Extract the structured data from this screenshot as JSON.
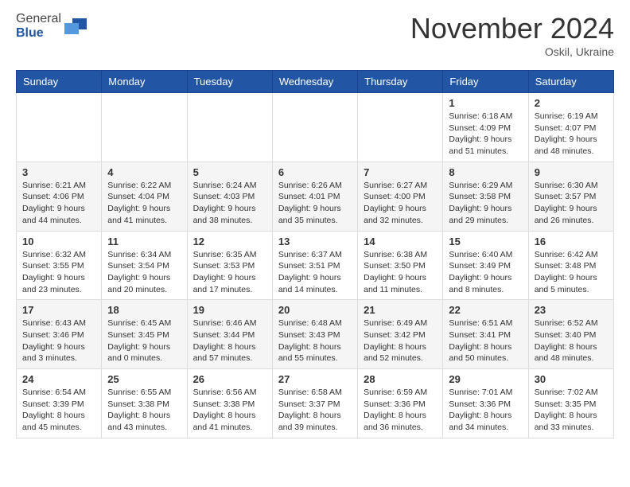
{
  "header": {
    "title": "November 2024",
    "location": "Oskil, Ukraine"
  },
  "columns": [
    "Sunday",
    "Monday",
    "Tuesday",
    "Wednesday",
    "Thursday",
    "Friday",
    "Saturday"
  ],
  "weeks": [
    [
      {
        "day": "",
        "info": ""
      },
      {
        "day": "",
        "info": ""
      },
      {
        "day": "",
        "info": ""
      },
      {
        "day": "",
        "info": ""
      },
      {
        "day": "",
        "info": ""
      },
      {
        "day": "1",
        "info": "Sunrise: 6:18 AM\nSunset: 4:09 PM\nDaylight: 9 hours and 51 minutes."
      },
      {
        "day": "2",
        "info": "Sunrise: 6:19 AM\nSunset: 4:07 PM\nDaylight: 9 hours and 48 minutes."
      }
    ],
    [
      {
        "day": "3",
        "info": "Sunrise: 6:21 AM\nSunset: 4:06 PM\nDaylight: 9 hours and 44 minutes."
      },
      {
        "day": "4",
        "info": "Sunrise: 6:22 AM\nSunset: 4:04 PM\nDaylight: 9 hours and 41 minutes."
      },
      {
        "day": "5",
        "info": "Sunrise: 6:24 AM\nSunset: 4:03 PM\nDaylight: 9 hours and 38 minutes."
      },
      {
        "day": "6",
        "info": "Sunrise: 6:26 AM\nSunset: 4:01 PM\nDaylight: 9 hours and 35 minutes."
      },
      {
        "day": "7",
        "info": "Sunrise: 6:27 AM\nSunset: 4:00 PM\nDaylight: 9 hours and 32 minutes."
      },
      {
        "day": "8",
        "info": "Sunrise: 6:29 AM\nSunset: 3:58 PM\nDaylight: 9 hours and 29 minutes."
      },
      {
        "day": "9",
        "info": "Sunrise: 6:30 AM\nSunset: 3:57 PM\nDaylight: 9 hours and 26 minutes."
      }
    ],
    [
      {
        "day": "10",
        "info": "Sunrise: 6:32 AM\nSunset: 3:55 PM\nDaylight: 9 hours and 23 minutes."
      },
      {
        "day": "11",
        "info": "Sunrise: 6:34 AM\nSunset: 3:54 PM\nDaylight: 9 hours and 20 minutes."
      },
      {
        "day": "12",
        "info": "Sunrise: 6:35 AM\nSunset: 3:53 PM\nDaylight: 9 hours and 17 minutes."
      },
      {
        "day": "13",
        "info": "Sunrise: 6:37 AM\nSunset: 3:51 PM\nDaylight: 9 hours and 14 minutes."
      },
      {
        "day": "14",
        "info": "Sunrise: 6:38 AM\nSunset: 3:50 PM\nDaylight: 9 hours and 11 minutes."
      },
      {
        "day": "15",
        "info": "Sunrise: 6:40 AM\nSunset: 3:49 PM\nDaylight: 9 hours and 8 minutes."
      },
      {
        "day": "16",
        "info": "Sunrise: 6:42 AM\nSunset: 3:48 PM\nDaylight: 9 hours and 5 minutes."
      }
    ],
    [
      {
        "day": "17",
        "info": "Sunrise: 6:43 AM\nSunset: 3:46 PM\nDaylight: 9 hours and 3 minutes."
      },
      {
        "day": "18",
        "info": "Sunrise: 6:45 AM\nSunset: 3:45 PM\nDaylight: 9 hours and 0 minutes."
      },
      {
        "day": "19",
        "info": "Sunrise: 6:46 AM\nSunset: 3:44 PM\nDaylight: 8 hours and 57 minutes."
      },
      {
        "day": "20",
        "info": "Sunrise: 6:48 AM\nSunset: 3:43 PM\nDaylight: 8 hours and 55 minutes."
      },
      {
        "day": "21",
        "info": "Sunrise: 6:49 AM\nSunset: 3:42 PM\nDaylight: 8 hours and 52 minutes."
      },
      {
        "day": "22",
        "info": "Sunrise: 6:51 AM\nSunset: 3:41 PM\nDaylight: 8 hours and 50 minutes."
      },
      {
        "day": "23",
        "info": "Sunrise: 6:52 AM\nSunset: 3:40 PM\nDaylight: 8 hours and 48 minutes."
      }
    ],
    [
      {
        "day": "24",
        "info": "Sunrise: 6:54 AM\nSunset: 3:39 PM\nDaylight: 8 hours and 45 minutes."
      },
      {
        "day": "25",
        "info": "Sunrise: 6:55 AM\nSunset: 3:38 PM\nDaylight: 8 hours and 43 minutes."
      },
      {
        "day": "26",
        "info": "Sunrise: 6:56 AM\nSunset: 3:38 PM\nDaylight: 8 hours and 41 minutes."
      },
      {
        "day": "27",
        "info": "Sunrise: 6:58 AM\nSunset: 3:37 PM\nDaylight: 8 hours and 39 minutes."
      },
      {
        "day": "28",
        "info": "Sunrise: 6:59 AM\nSunset: 3:36 PM\nDaylight: 8 hours and 36 minutes."
      },
      {
        "day": "29",
        "info": "Sunrise: 7:01 AM\nSunset: 3:36 PM\nDaylight: 8 hours and 34 minutes."
      },
      {
        "day": "30",
        "info": "Sunrise: 7:02 AM\nSunset: 3:35 PM\nDaylight: 8 hours and 33 minutes."
      }
    ]
  ]
}
